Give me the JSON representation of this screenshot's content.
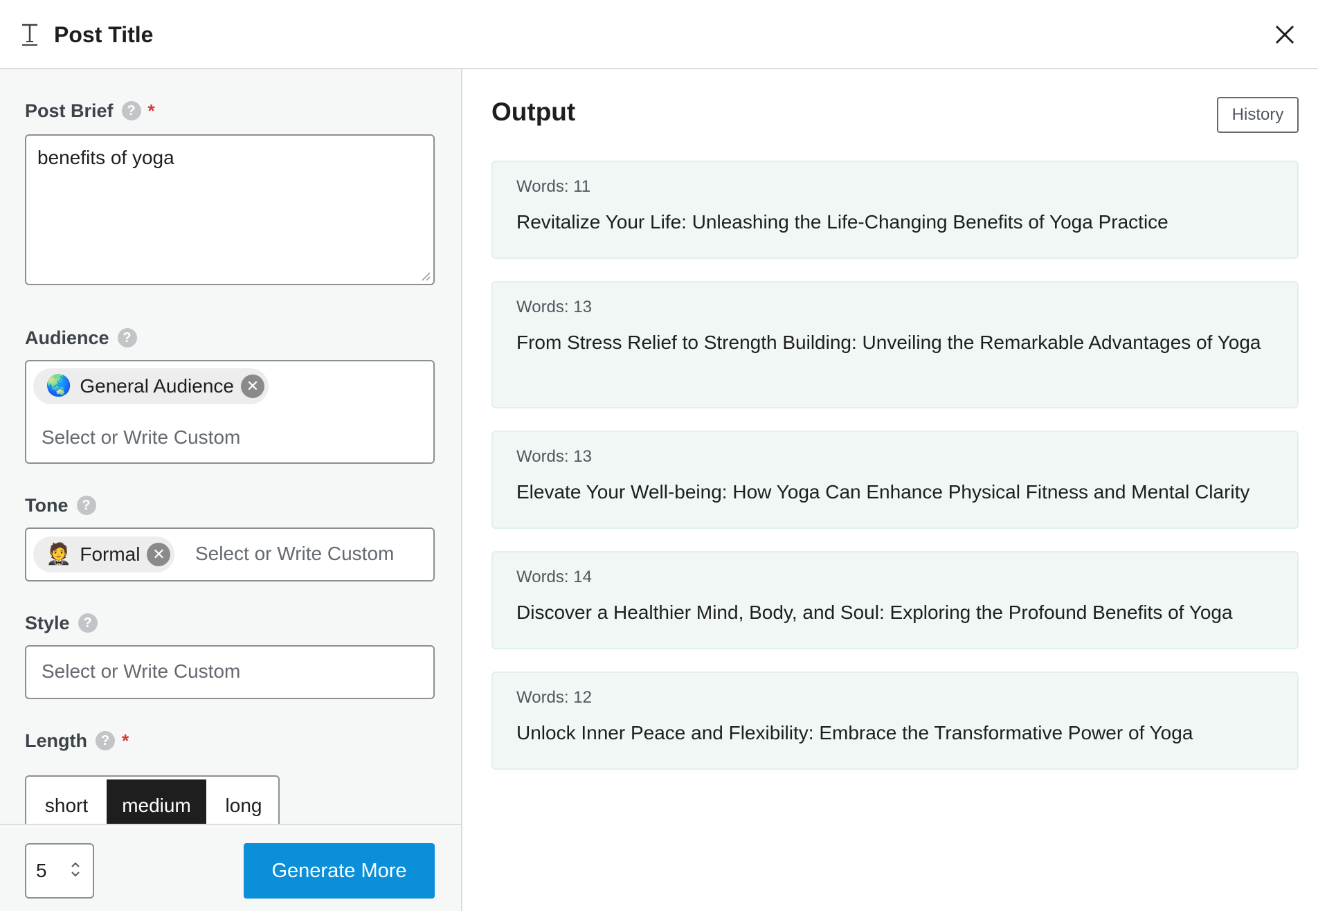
{
  "header": {
    "title": "Post Title",
    "title_icon": "text-type-icon",
    "close_icon": "close-icon"
  },
  "form": {
    "post_brief": {
      "label": "Post Brief",
      "help": "?",
      "required_mark": "*",
      "value": "benefits of yoga"
    },
    "audience": {
      "label": "Audience",
      "help": "?",
      "chip": {
        "emoji": "🌏",
        "label": "General Audience"
      },
      "placeholder": "Select or Write Custom"
    },
    "tone": {
      "label": "Tone",
      "help": "?",
      "chip": {
        "emoji": "🤵",
        "label": "Formal"
      },
      "placeholder": "Select or Write Custom"
    },
    "style": {
      "label": "Style",
      "help": "?",
      "placeholder": "Select or Write Custom"
    },
    "length": {
      "label": "Length",
      "help": "?",
      "required_mark": "*",
      "options": [
        "short",
        "medium",
        "long"
      ],
      "selected": "medium"
    }
  },
  "footer": {
    "count": "5",
    "generate_label": "Generate More"
  },
  "output": {
    "title": "Output",
    "history_label": "History",
    "results": [
      {
        "words": "Words: 11",
        "text": "Revitalize Your Life: Unleashing the Life-Changing Benefits of Yoga Practice"
      },
      {
        "words": "Words: 13",
        "text": "From Stress Relief to Strength Building: Unveiling the Remarkable Advantages of Yoga"
      },
      {
        "words": "Words: 13",
        "text": "Elevate Your Well-being: How Yoga Can Enhance Physical Fitness and Mental Clarity"
      },
      {
        "words": "Words: 14",
        "text": "Discover a Healthier Mind, Body, and Soul: Exploring the Profound Benefits of Yoga"
      },
      {
        "words": "Words: 12",
        "text": "Unlock Inner Peace and Flexibility: Embrace the Transformative Power of Yoga"
      }
    ]
  },
  "colors": {
    "primary_button": "#0b8fd8",
    "card_bg": "#f0f7f4",
    "required": "#d63638",
    "selected_segment": "#1e1e1e"
  }
}
